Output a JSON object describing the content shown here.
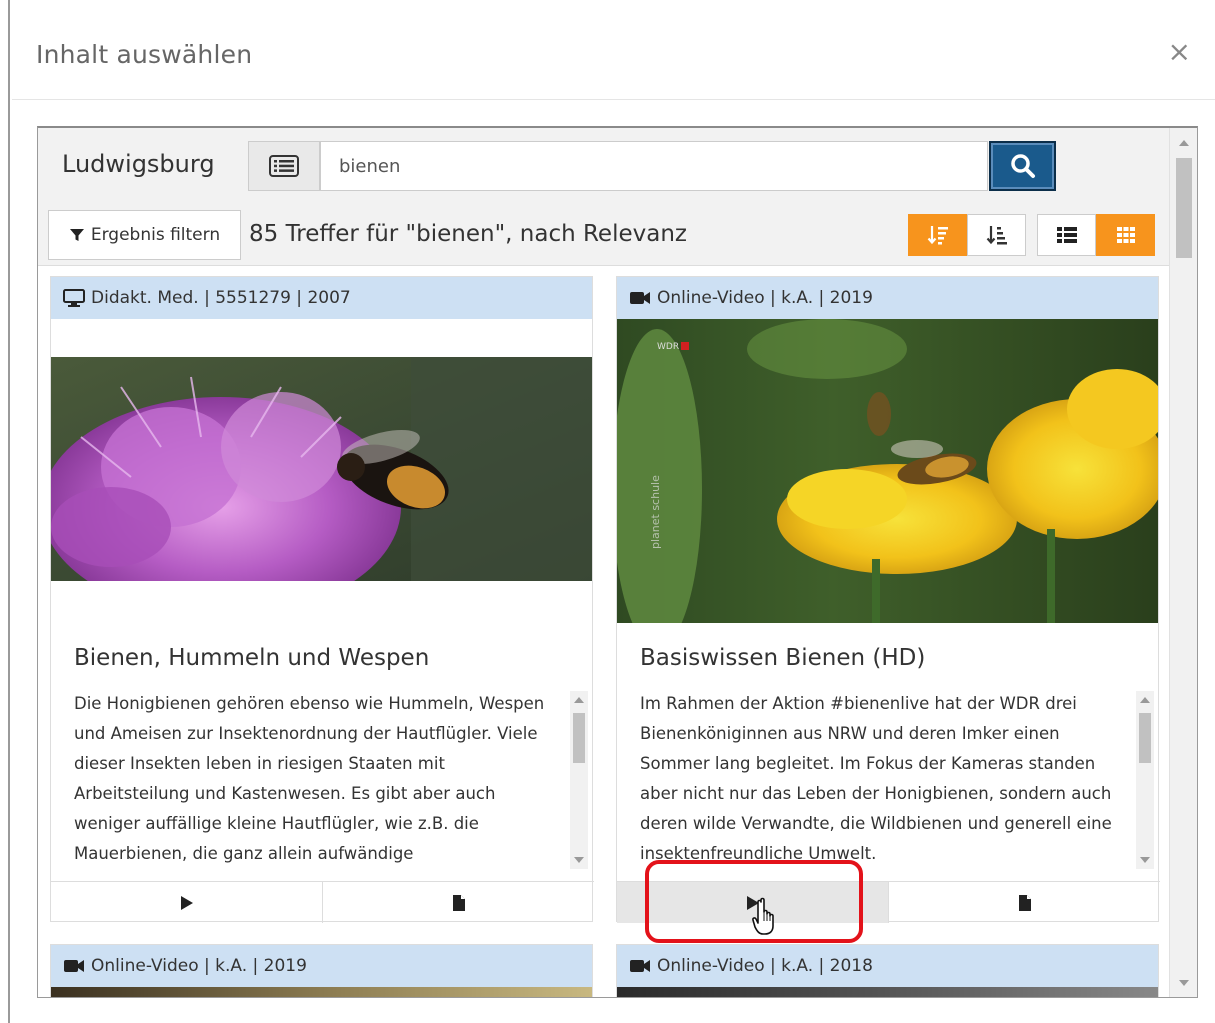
{
  "dialog": {
    "title": "Inhalt auswählen",
    "close_symbol": "×"
  },
  "search": {
    "library": "Ludwigsburg",
    "query": "bienen",
    "filter_label": "Ergebnis filtern",
    "result_text": "85 Treffer für \"bienen\", nach Relevanz"
  },
  "colors": {
    "accent": "#f7941d",
    "search_button": "#1a5a8c",
    "card_header": "#cde0f3",
    "highlight": "#e3121a"
  },
  "cards": [
    {
      "meta": "Didakt. Med. | 5551279 | 2007",
      "icon": "monitor-icon",
      "title": "Bienen, Hummeln und Wespen",
      "description": "Die Honigbienen gehören ebenso wie Hummeln, Wespen und Ameisen zur Insektenordnung der Hautflügler. Viele dieser Insekten leben in riesigen Staaten mit Arbeitsteilung und Kastenwesen. Es gibt aber auch weniger auffällige kleine Hautflügler, wie z.B. die Mauerbienen, die ganz allein aufwändige"
    },
    {
      "meta": "Online-Video | k.A. | 2019",
      "icon": "video-camera-icon",
      "title": "Basiswissen Bienen (HD)",
      "description": "Im Rahmen der Aktion #bienenlive hat der WDR drei Bienenköniginnen aus NRW und deren Imker einen Sommer lang begleitet. Im Fokus der Kameras standen aber nicht nur das Leben der Honigbienen, sondern auch deren wilde Verwandte, die Wildbienen und generell eine insektenfreundliche Umwelt."
    },
    {
      "meta": "Online-Video | k.A. | 2019",
      "icon": "video-camera-icon"
    },
    {
      "meta": "Online-Video | k.A. | 2018",
      "icon": "video-camera-icon"
    }
  ],
  "image_overlay": {
    "wdr_logo": "WDR",
    "watermark": "planet schule"
  }
}
